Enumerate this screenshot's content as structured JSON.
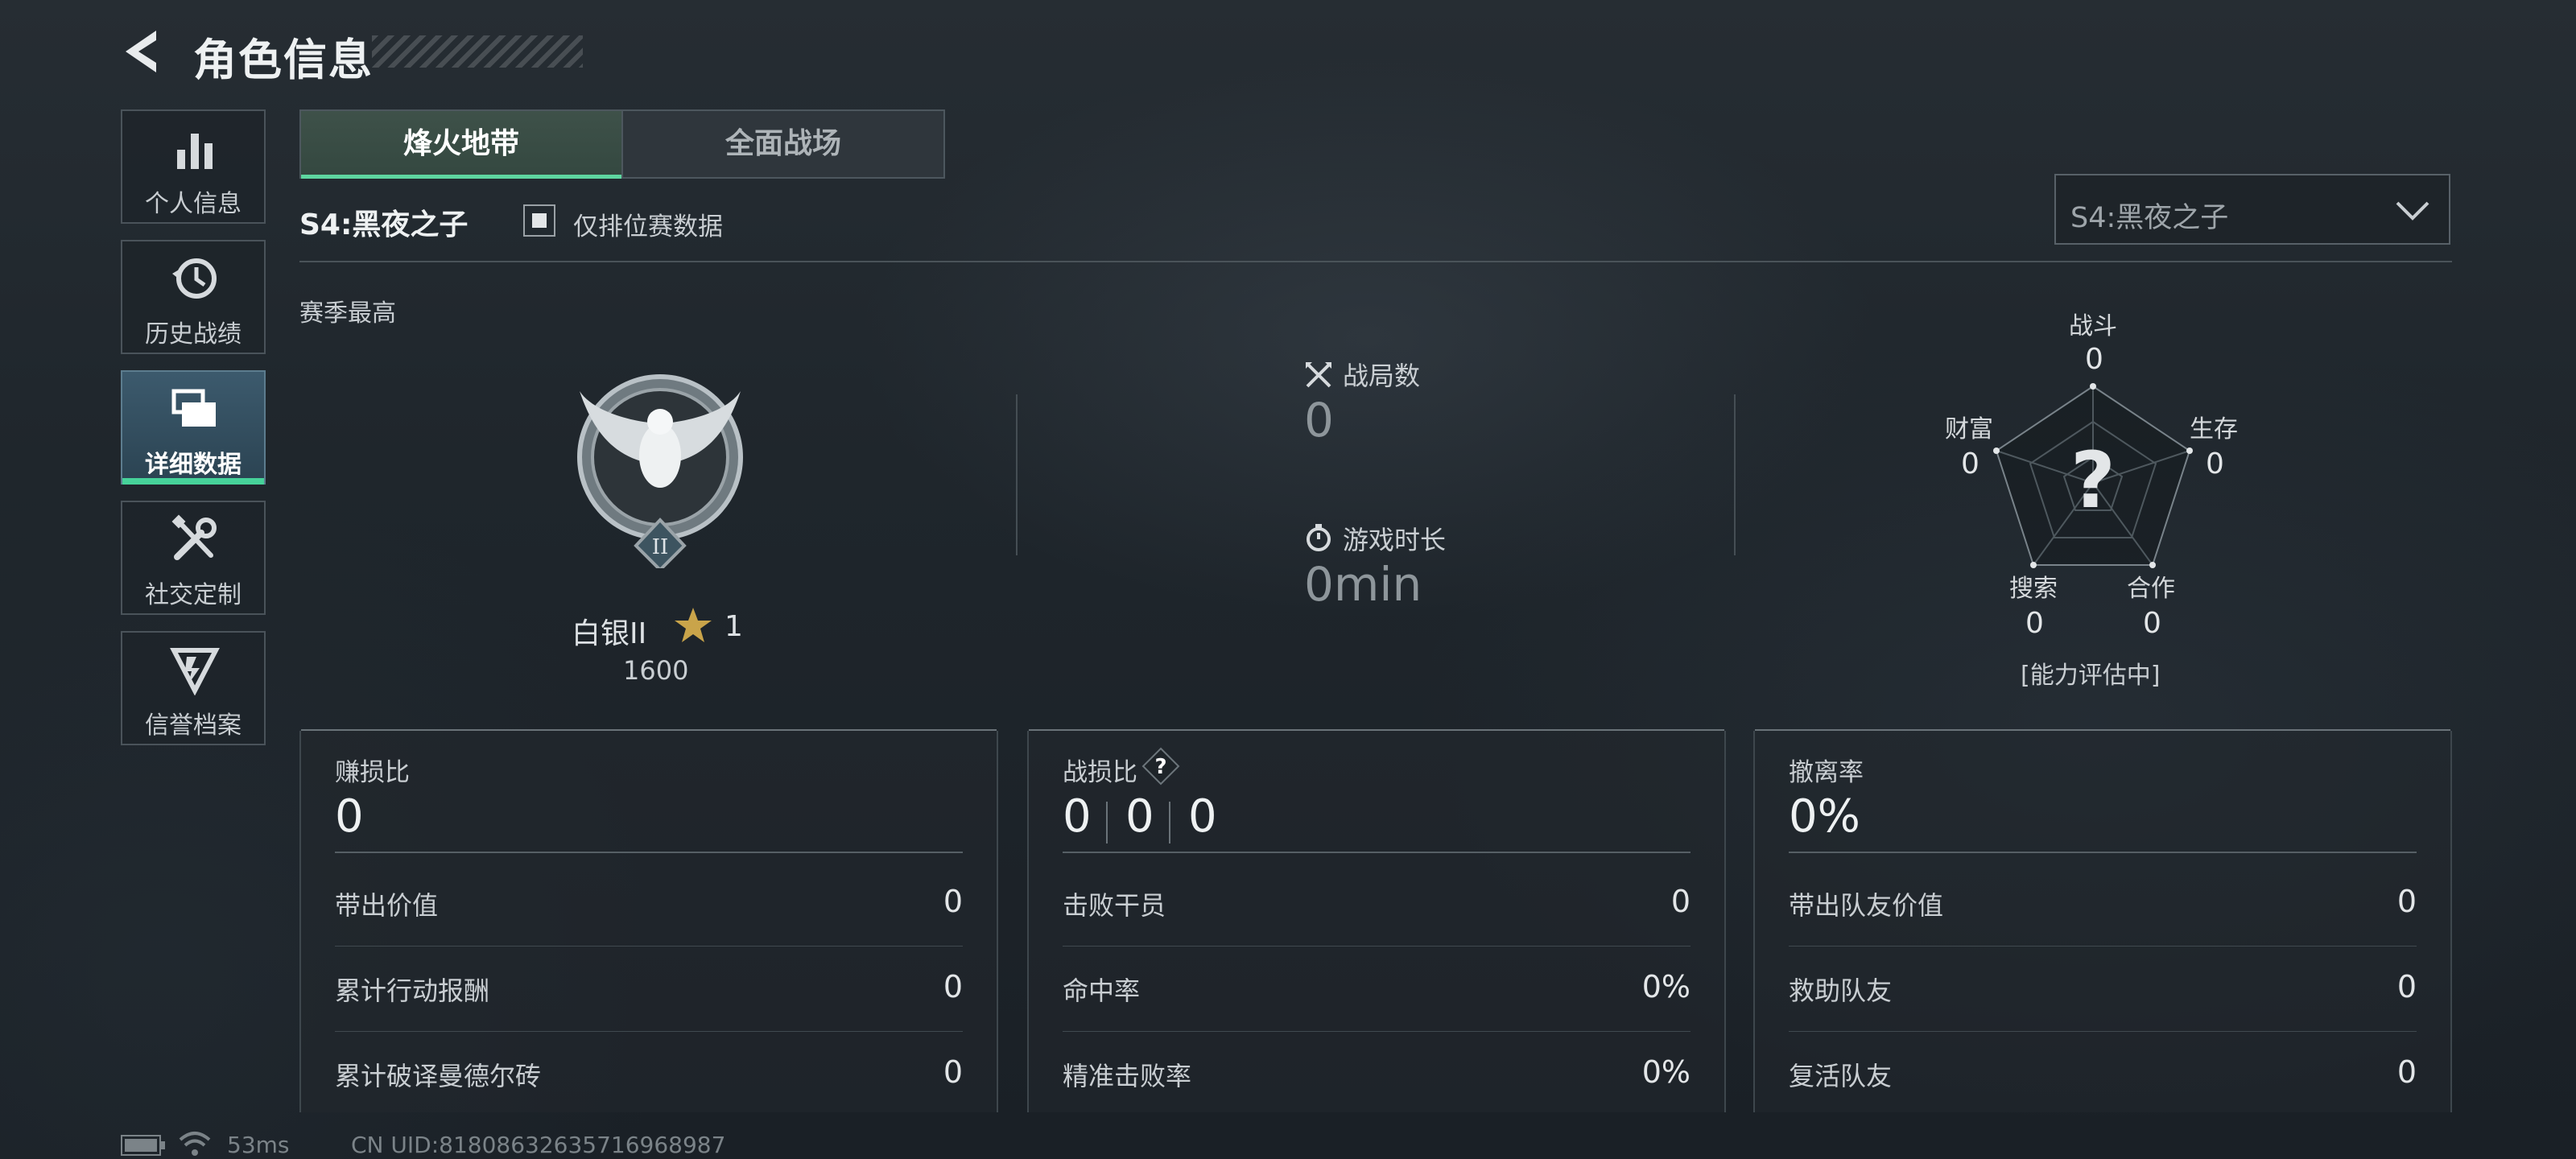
{
  "header": {
    "title": "角色信息"
  },
  "sidebar": {
    "items": [
      {
        "label": "个人信息",
        "icon": "bar-chart-icon",
        "active": false
      },
      {
        "label": "历史战绩",
        "icon": "history-clock-icon",
        "active": false
      },
      {
        "label": "详细数据",
        "icon": "folder-stack-icon",
        "active": true
      },
      {
        "label": "社交定制",
        "icon": "tools-icon",
        "active": false
      },
      {
        "label": "信誉档案",
        "icon": "credit-badge-icon",
        "active": false
      }
    ]
  },
  "tabs": [
    {
      "label": "烽火地带",
      "active": true
    },
    {
      "label": "全面战场",
      "active": false
    }
  ],
  "season": {
    "name": "S4:黑夜之子",
    "ranked_only_label": "仅排位赛数据",
    "ranked_only_checked": true,
    "select_value": "S4:黑夜之子",
    "best_label": "赛季最高"
  },
  "rank": {
    "name": "白银II",
    "emblem_numeral": "II",
    "stars": "1",
    "score": "1600"
  },
  "matches": {
    "count_label": "战局数",
    "count_value": "0",
    "time_label": "游戏时长",
    "time_value": "0min"
  },
  "ability": {
    "axes": [
      {
        "label": "战斗",
        "value": "0"
      },
      {
        "label": "生存",
        "value": "0"
      },
      {
        "label": "合作",
        "value": "0"
      },
      {
        "label": "搜索",
        "value": "0"
      },
      {
        "label": "财富",
        "value": "0"
      }
    ],
    "center_symbol": "?",
    "status": "[能力评估中]"
  },
  "cards": {
    "profit": {
      "label": "赚损比",
      "value": "0",
      "rows": [
        {
          "label": "带出价值",
          "value": "0"
        },
        {
          "label": "累计行动报酬",
          "value": "0"
        },
        {
          "label": "累计破译曼德尔砖",
          "value": "0"
        }
      ]
    },
    "kd": {
      "label": "战损比",
      "help_symbol": "?",
      "values": [
        "0",
        "0",
        "0"
      ],
      "rows": [
        {
          "label": "击败干员",
          "value": "0"
        },
        {
          "label": "命中率",
          "value": "0%"
        },
        {
          "label": "精准击败率",
          "value": "0%"
        }
      ]
    },
    "extract": {
      "label": "撤离率",
      "value": "0%",
      "rows": [
        {
          "label": "带出队友价值",
          "value": "0"
        },
        {
          "label": "救助队友",
          "value": "0"
        },
        {
          "label": "复活队友",
          "value": "0"
        }
      ]
    }
  },
  "status_bar": {
    "ping": "53ms",
    "uid": "CN UID:81808632635716968987"
  },
  "colors": {
    "accent_green": "#46d29a",
    "active_nav": "#3c5a6d",
    "gold_star": "#c9a44a"
  }
}
